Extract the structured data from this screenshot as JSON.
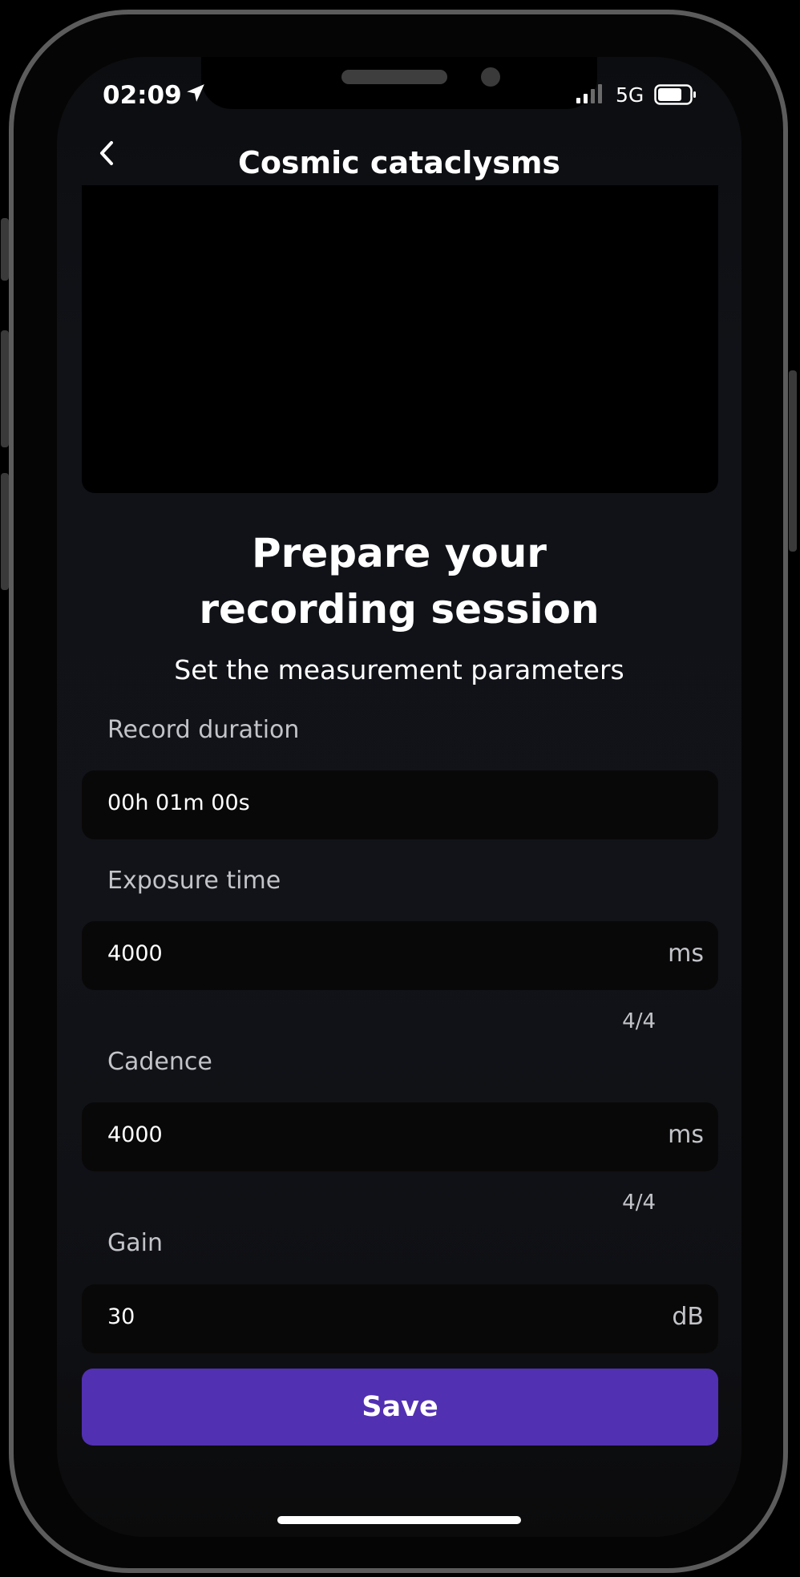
{
  "status_bar": {
    "time": "02:09",
    "network": "5G"
  },
  "header": {
    "title": "Cosmic cataclysms",
    "back_icon": "chevron-left-icon"
  },
  "main": {
    "headline_line1": "Prepare your",
    "headline_line2": "recording session",
    "subtitle": "Set the measurement parameters"
  },
  "fields": {
    "record_duration": {
      "label": "Record duration",
      "value": "00h 01m 00s"
    },
    "exposure_time": {
      "label": "Exposure time",
      "value": "4000",
      "unit": "ms",
      "counter": "4/4"
    },
    "cadence": {
      "label": "Cadence",
      "value": "4000",
      "unit": "ms",
      "counter": "4/4"
    },
    "gain": {
      "label": "Gain",
      "value": "30",
      "unit": "dB"
    }
  },
  "actions": {
    "save_label": "Save"
  },
  "colors": {
    "accent": "#5230b2",
    "background": "#111318",
    "field_background": "#090808",
    "muted_text": "#c2c4c9"
  }
}
